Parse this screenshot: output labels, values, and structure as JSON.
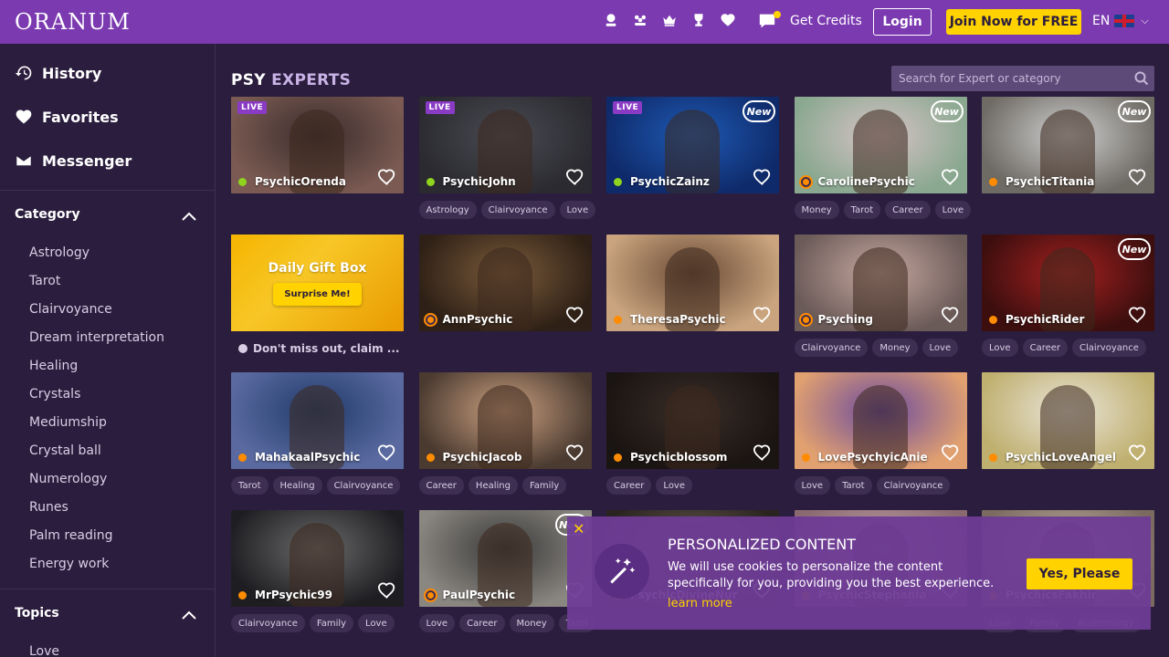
{
  "header": {
    "logo": "ORANUM",
    "icons": [
      "psychic-icon",
      "community-icon",
      "crown-icon",
      "trophy-icon",
      "heart-icon"
    ],
    "chat_icon": "chat-icon",
    "get_credits": "Get Credits",
    "login": "Login",
    "join": "Join Now for FREE",
    "lang": "EN",
    "accent": "#7b3ab0",
    "cta_color": "#ffd200"
  },
  "sidebar": {
    "main": [
      {
        "label": "History",
        "icon": "history-icon"
      },
      {
        "label": "Favorites",
        "icon": "heart-icon"
      },
      {
        "label": "Messenger",
        "icon": "envelope-icon"
      }
    ],
    "category": {
      "title": "Category",
      "items": [
        "Astrology",
        "Tarot",
        "Clairvoyance",
        "Dream interpretation",
        "Healing",
        "Crystals",
        "Mediumship",
        "Crystal ball",
        "Numerology",
        "Runes",
        "Palm reading",
        "Energy work"
      ]
    },
    "topics": {
      "title": "Topics",
      "items": [
        "Love"
      ]
    }
  },
  "main": {
    "title_1": "PSY",
    "title_2": "EXPERTS",
    "search_placeholder": "Search for Expert or category",
    "gift": {
      "title": "Daily Gift Box",
      "button": "Surprise Me!",
      "message": "Don't miss out, claim ..."
    },
    "cards": [
      {
        "name": "PsychicOrenda",
        "live": "LIVE",
        "new": "",
        "status": "online",
        "tags": []
      },
      {
        "name": "PsychicJohn",
        "live": "LIVE",
        "new": "",
        "status": "online",
        "tags": [
          "Astrology",
          "Clairvoyance",
          "Love"
        ]
      },
      {
        "name": "PsychicZainz",
        "live": "LIVE",
        "new": "New",
        "status": "online",
        "tags": []
      },
      {
        "name": "CarolinePsychic",
        "live": "",
        "new": "New",
        "status": "ring",
        "tags": [
          "Money",
          "Tarot",
          "Career",
          "Love"
        ]
      },
      {
        "name": "PsychicTitania",
        "live": "",
        "new": "New",
        "status": "away",
        "tags": []
      },
      {
        "name": "GIFT",
        "live": "",
        "new": "",
        "status": "",
        "tags": []
      },
      {
        "name": "AnnPsychic",
        "live": "",
        "new": "",
        "status": "ring",
        "tags": []
      },
      {
        "name": "TheresaPsychic",
        "live": "",
        "new": "",
        "status": "away",
        "tags": []
      },
      {
        "name": "Psyching",
        "live": "",
        "new": "",
        "status": "ring",
        "tags": [
          "Clairvoyance",
          "Money",
          "Love"
        ]
      },
      {
        "name": "PsychicRider",
        "live": "",
        "new": "New",
        "status": "away",
        "tags": [
          "Love",
          "Career",
          "Clairvoyance"
        ]
      },
      {
        "name": "MahakaalPsychic",
        "live": "",
        "new": "",
        "status": "away",
        "tags": [
          "Tarot",
          "Healing",
          "Clairvoyance"
        ]
      },
      {
        "name": "PsychicJacob",
        "live": "",
        "new": "",
        "status": "away",
        "tags": [
          "Career",
          "Healing",
          "Family"
        ]
      },
      {
        "name": "Psychicblossom",
        "live": "",
        "new": "",
        "status": "away",
        "tags": [
          "Career",
          "Love"
        ]
      },
      {
        "name": "LovePsychyicAnie",
        "live": "",
        "new": "",
        "status": "away",
        "tags": [
          "Love",
          "Tarot",
          "Clairvoyance"
        ]
      },
      {
        "name": "PsychicLoveAngel",
        "live": "",
        "new": "",
        "status": "away",
        "tags": []
      },
      {
        "name": "MrPsychic99",
        "live": "",
        "new": "",
        "status": "away",
        "tags": [
          "Clairvoyance",
          "Family",
          "Love"
        ]
      },
      {
        "name": "PaulPsychic",
        "live": "",
        "new": "New",
        "status": "ring",
        "tags": [
          "Love",
          "Career",
          "Money",
          "Tarot"
        ]
      },
      {
        "name": "PsychicDivineNur",
        "live": "",
        "new": "",
        "status": "away",
        "tags": []
      },
      {
        "name": "PsychicStephania",
        "live": "",
        "new": "",
        "status": "away",
        "tags": []
      },
      {
        "name": "PsychicsFakhir",
        "live": "",
        "new": "",
        "status": "away",
        "tags": [
          "Love",
          "Family",
          "Numerology"
        ]
      }
    ]
  },
  "cookie": {
    "close": "✕",
    "title": "PERSONALIZED CONTENT",
    "text": "We will use cookies to personalize the content specifically for you, providing you the best experience.",
    "link": "learn more",
    "button": "Yes, Please",
    "icon": "magic-wand-icon"
  }
}
